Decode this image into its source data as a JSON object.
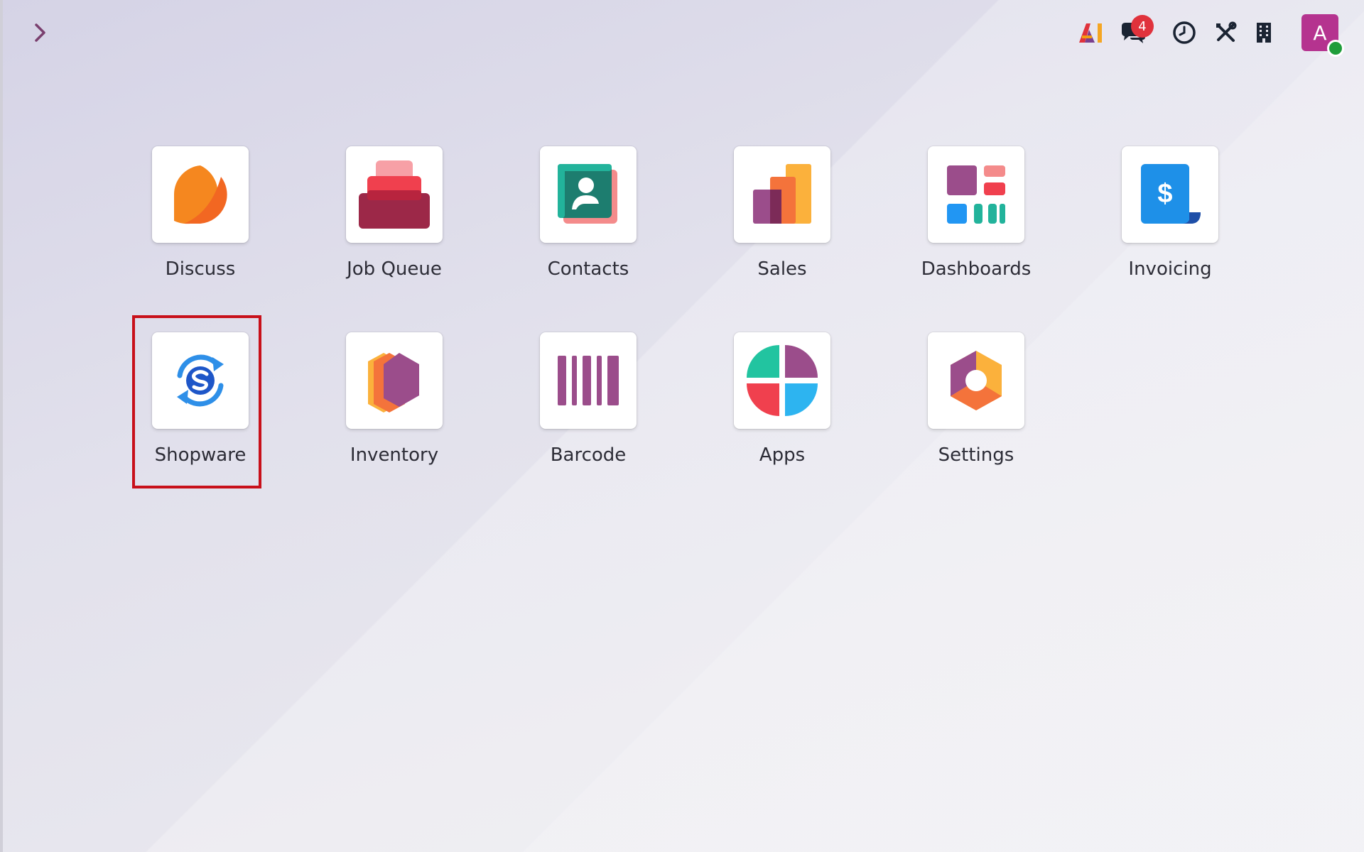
{
  "topbar": {
    "menu_toggle_icon": "chevron-right-icon",
    "systray": {
      "ai_icon": "ai-logo-icon",
      "messages_icon": "chat-bubbles-icon",
      "messages_count": "4",
      "activity_icon": "clock-icon",
      "debug_icon": "tools-icon",
      "company_icon": "building-icon",
      "user_initial": "A"
    }
  },
  "apps": [
    {
      "label": "Discuss",
      "icon": "discuss-icon"
    },
    {
      "label": "Job Queue",
      "icon": "job-queue-icon"
    },
    {
      "label": "Contacts",
      "icon": "contacts-icon"
    },
    {
      "label": "Sales",
      "icon": "sales-icon"
    },
    {
      "label": "Dashboards",
      "icon": "dashboards-icon"
    },
    {
      "label": "Invoicing",
      "icon": "invoicing-icon"
    },
    {
      "label": "Shopware",
      "icon": "shopware-icon"
    },
    {
      "label": "Inventory",
      "icon": "inventory-icon"
    },
    {
      "label": "Barcode",
      "icon": "barcode-icon"
    },
    {
      "label": "Apps",
      "icon": "apps-icon"
    },
    {
      "label": "Settings",
      "icon": "settings-icon"
    }
  ],
  "colors": {
    "highlight": "#c8101a",
    "badge": "#e0323c",
    "avatar": "#b5338f",
    "presence": "#1f9d3a"
  }
}
